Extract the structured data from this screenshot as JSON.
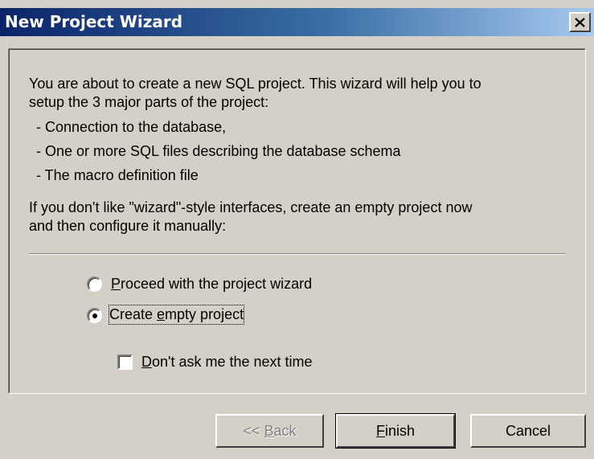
{
  "window": {
    "title": "New Project Wizard",
    "close_label": "×"
  },
  "intro": {
    "line1": "You are about to create a new SQL project. This wizard will help you to",
    "line2": "setup the 3 major parts of the project:",
    "items": [
      "- Connection to the database,",
      "- One or more SQL files describing the database schema",
      "- The macro definition file"
    ],
    "outro1": "If you don't like \"wizard\"-style interfaces,  create an empty project now",
    "outro2": "and  then configure it manually:"
  },
  "options": {
    "proceed": {
      "mnemonic": "P",
      "rest": "roceed with the project wizard",
      "checked": false
    },
    "create": {
      "before": "Create ",
      "mnemonic": "e",
      "rest": "mpty project",
      "checked": true
    },
    "dont_ask": {
      "mnemonic": "D",
      "rest": "on't ask me the next time",
      "checked": false
    }
  },
  "buttons": {
    "back": {
      "prefix": "<< ",
      "mnemonic": "B",
      "rest": "ack",
      "enabled": false
    },
    "finish": {
      "mnemonic": "F",
      "rest": "inish",
      "default": true
    },
    "cancel": {
      "label": "Cancel"
    }
  }
}
